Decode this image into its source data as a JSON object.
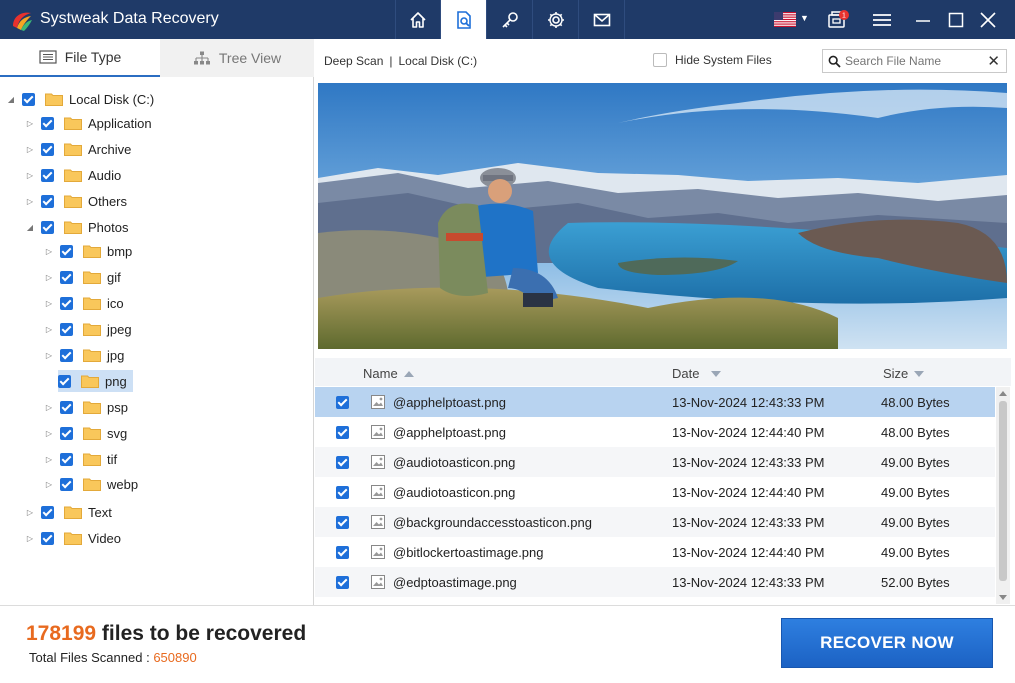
{
  "app": {
    "title": "Systweak Data Recovery"
  },
  "nav": {
    "items": [
      {
        "icon": "home-icon",
        "active": false
      },
      {
        "icon": "scan-document-icon",
        "active": true
      },
      {
        "icon": "key-icon",
        "active": false
      },
      {
        "icon": "gear-icon",
        "active": false
      },
      {
        "icon": "mail-icon",
        "active": false
      }
    ],
    "badge_count": "1"
  },
  "tabs": {
    "file_type": "File Type",
    "tree_view": "Tree View"
  },
  "tree": {
    "root": "Local Disk (C:)",
    "items": [
      "Application",
      "Archive",
      "Audio",
      "Others",
      "Photos",
      "bmp",
      "gif",
      "ico",
      "jpeg",
      "jpg",
      "png",
      "psp",
      "svg",
      "tif",
      "webp",
      "Text",
      "Video"
    ]
  },
  "header": {
    "scan": "Deep Scan",
    "separator": "|",
    "disk": "Local Disk (C:)",
    "hide_system": "Hide System Files",
    "search_placeholder": "Search File Name"
  },
  "list": {
    "columns": {
      "name": "Name",
      "date": "Date",
      "size": "Size"
    },
    "rows": [
      {
        "name": "@apphelptoast.png",
        "date": "13-Nov-2024 12:43:33 PM",
        "size": "48.00 Bytes"
      },
      {
        "name": "@apphelptoast.png",
        "date": "13-Nov-2024 12:44:40 PM",
        "size": "48.00 Bytes"
      },
      {
        "name": "@audiotoasticon.png",
        "date": "13-Nov-2024 12:43:33 PM",
        "size": "49.00 Bytes"
      },
      {
        "name": "@audiotoasticon.png",
        "date": "13-Nov-2024 12:44:40 PM",
        "size": "49.00 Bytes"
      },
      {
        "name": "@backgroundaccesstoasticon.png",
        "date": "13-Nov-2024 12:43:33 PM",
        "size": "49.00 Bytes"
      },
      {
        "name": "@bitlockertoastimage.png",
        "date": "13-Nov-2024 12:44:40 PM",
        "size": "49.00 Bytes"
      },
      {
        "name": "@edptoastimage.png",
        "date": "13-Nov-2024 12:43:33 PM",
        "size": "52.00 Bytes"
      }
    ]
  },
  "footer": {
    "count": "178199",
    "count_suffix": "files to be recovered",
    "scanned_label": "Total Files Scanned :",
    "scanned_value": "650890",
    "recover_button": "RECOVER NOW"
  },
  "colors": {
    "titlebar": "#1f3a68",
    "accent": "#1e6fd9",
    "highlight": "#e86a1f",
    "selected_row": "#b8d3f0"
  }
}
